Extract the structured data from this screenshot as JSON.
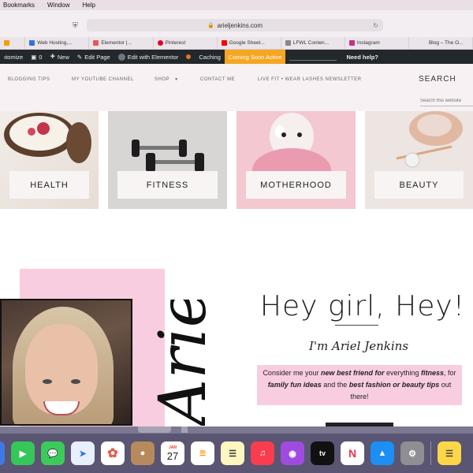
{
  "menubar": {
    "items": [
      "Bookmarks",
      "Window",
      "Help"
    ]
  },
  "browser": {
    "url": "arieljenkins.com",
    "tabs": [
      {
        "label": "",
        "color": "#f0a000"
      },
      {
        "label": "Web Hosting,...",
        "color": "#3b6fd8"
      },
      {
        "label": "Elementor |...",
        "color": "#e35a5a"
      },
      {
        "label": "Pinterest",
        "color": "#e60023"
      },
      {
        "label": "Google Sheet...",
        "color": "#ff0000"
      },
      {
        "label": "LFWL Conten...",
        "color": "#888888"
      },
      {
        "label": "Instagram",
        "color": "#c13584"
      },
      {
        "label": "Blog – The O...",
        "color": "#bbbbbb"
      }
    ]
  },
  "adminbar": {
    "customize": "ıtomize",
    "comments": "0",
    "new": "New",
    "edit_page": "Edit Page",
    "edit_elementor": "Edit with Elementor",
    "caching": "Caching",
    "coming_soon": "Coming Soon Active",
    "need_help": "Need help?"
  },
  "nav": {
    "items": [
      "BLOGGING TIPS",
      "MY YOUTUBE CHANNEL",
      "SHOP",
      "CONTACT ME",
      "LIVE FIT • WEAR LASHES NEWSLETTER"
    ],
    "search_label": "SEARCH",
    "search_placeholder": "Search this website"
  },
  "categories": [
    "HEALTH",
    "FITNESS",
    "MOTHERHOOD",
    "BEAUTY"
  ],
  "hero": {
    "script_name": "Ariel",
    "headline": "Hey girl, Hey!",
    "subhead": "I'm Ariel Jenkins",
    "intro_1": "Consider me your ",
    "intro_2": "new best friend for",
    "intro_3": " everything ",
    "intro_4": "fitness",
    "intro_5": ", for ",
    "intro_6": "family fun ideas",
    "intro_7": " and the ",
    "intro_8": "best fashion or beauty tips",
    "intro_9": " out there!"
  },
  "dock": {
    "calendar_month": "JAN",
    "calendar_day": "27",
    "tv_label": "tv"
  },
  "colors": {
    "accent_pink": "#f9cde0",
    "admin_bar": "#23282d",
    "coming_soon": "#f5a623"
  }
}
